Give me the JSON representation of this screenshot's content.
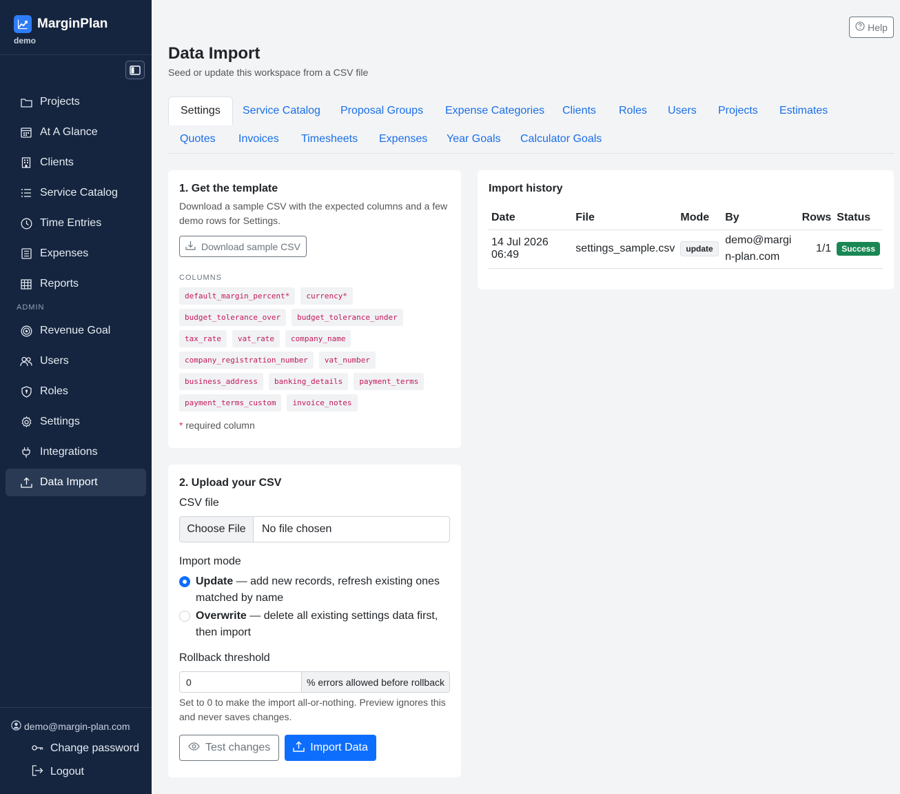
{
  "brand": {
    "name": "MarginPlan",
    "workspace": "demo"
  },
  "sidebar": {
    "items": [
      {
        "label": "Projects",
        "icon": "folder-icon"
      },
      {
        "label": "At A Glance",
        "icon": "calendar-icon"
      },
      {
        "label": "Clients",
        "icon": "building-icon"
      },
      {
        "label": "Service Catalog",
        "icon": "list-icon"
      },
      {
        "label": "Time Entries",
        "icon": "clock-icon"
      },
      {
        "label": "Expenses",
        "icon": "receipt-icon"
      },
      {
        "label": "Reports",
        "icon": "table-icon"
      }
    ],
    "admin_label": "ADMIN",
    "admin_items": [
      {
        "label": "Revenue Goal",
        "icon": "target-icon"
      },
      {
        "label": "Users",
        "icon": "users-icon"
      },
      {
        "label": "Roles",
        "icon": "shield-icon"
      },
      {
        "label": "Settings",
        "icon": "gear-icon"
      },
      {
        "label": "Integrations",
        "icon": "plug-icon"
      },
      {
        "label": "Data Import",
        "icon": "upload-icon"
      }
    ],
    "user_email": "demo@margin-plan.com",
    "change_password": "Change password",
    "logout": "Logout"
  },
  "header": {
    "help": "Help",
    "title": "Data Import",
    "subtitle": "Seed or update this workspace from a CSV file"
  },
  "tabs": [
    "Settings",
    "Service Catalog",
    "Proposal Groups",
    "Expense Categories",
    "Clients",
    "Roles",
    "Users",
    "Projects",
    "Estimates",
    "Quotes",
    "Invoices",
    "Timesheets",
    "Expenses",
    "Year Goals",
    "Calculator Goals"
  ],
  "template": {
    "title": "1. Get the template",
    "description": "Download a sample CSV with the expected columns and a few demo rows for Settings.",
    "download_label": "Download sample CSV",
    "columns_label": "COLUMNS",
    "columns": [
      "default_margin_percent*",
      "currency*",
      "budget_tolerance_over",
      "budget_tolerance_under",
      "tax_rate",
      "vat_rate",
      "company_name",
      "company_registration_number",
      "vat_number",
      "business_address",
      "banking_details",
      "payment_terms",
      "payment_terms_custom",
      "invoice_notes"
    ],
    "required_star": "*",
    "required_note": "required column"
  },
  "upload": {
    "title": "2. Upload your CSV",
    "file_label": "CSV file",
    "choose_file": "Choose File",
    "no_file": "No file chosen",
    "mode_label": "Import mode",
    "update_title": "Update",
    "update_desc": " — add new records, refresh existing ones matched by name",
    "overwrite_title": "Overwrite",
    "overwrite_desc": " — delete all existing settings data first, then import",
    "threshold_label": "Rollback threshold",
    "threshold_value": "0",
    "threshold_addon": "% errors allowed before rollback",
    "threshold_help": "Set to 0 to make the import all-or-nothing. Preview ignores this and never saves changes.",
    "test_button": "Test changes",
    "import_button": "Import Data"
  },
  "history": {
    "title": "Import history",
    "headers": [
      "Date",
      "File",
      "Mode",
      "By",
      "Rows",
      "Status"
    ],
    "rows": [
      {
        "date": "14 Jul 2026 06:49",
        "file": "settings_sample.csv",
        "mode": "update",
        "by": "demo@margin-plan.com",
        "rows": "1/1",
        "status": "Success"
      }
    ]
  },
  "colors": {
    "sidebar_bg": "#15253f",
    "accent": "#0d6efd",
    "link": "#1a6fe8",
    "success": "#198754",
    "chip_text": "#c2185b"
  }
}
